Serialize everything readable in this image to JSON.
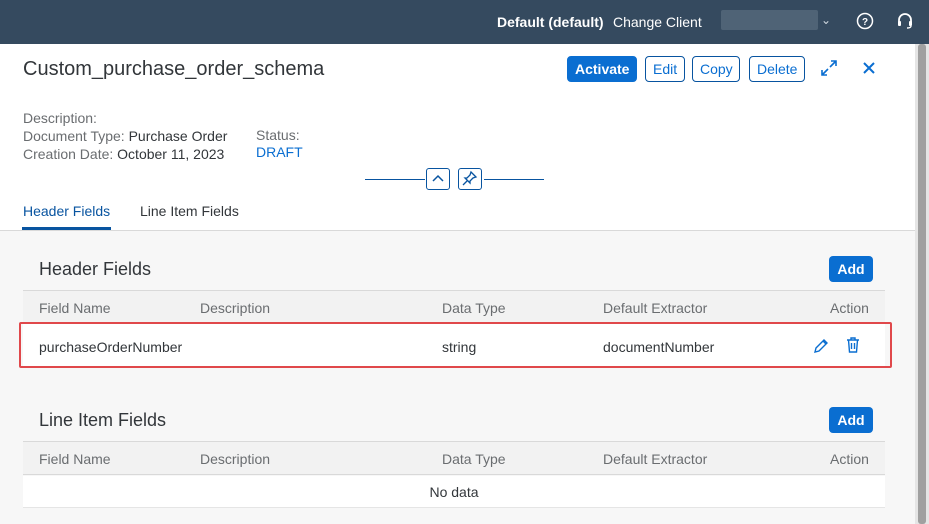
{
  "shell": {
    "system": "Default (default)",
    "change_client": "Change Client",
    "help_icon": "help-icon",
    "support_icon": "headset-icon"
  },
  "object": {
    "title": "Custom_purchase_order_schema",
    "actions": {
      "activate": "Activate",
      "edit": "Edit",
      "copy": "Copy",
      "delete": "Delete"
    },
    "description_label": "Description:",
    "doc_type_label": "Document Type:",
    "doc_type_value": "Purchase Order",
    "creation_label": "Creation Date:",
    "creation_value": "October 11, 2023",
    "status_label": "Status:",
    "status_value": "DRAFT"
  },
  "tabs": [
    "Header Fields",
    "Line Item Fields"
  ],
  "columns": [
    "Field Name",
    "Description",
    "Data Type",
    "Default Extractor",
    "Action"
  ],
  "header_section": {
    "title": "Header Fields",
    "add": "Add",
    "rows": [
      {
        "field_name": "purchaseOrderNumber",
        "description": "",
        "data_type": "string",
        "default_extractor": "documentNumber"
      }
    ]
  },
  "line_section": {
    "title": "Line Item Fields",
    "add": "Add",
    "empty_text": "No data"
  },
  "colors": {
    "shell": "#354a5f",
    "accent": "#0a6ed1",
    "highlight": "#e0484b"
  }
}
